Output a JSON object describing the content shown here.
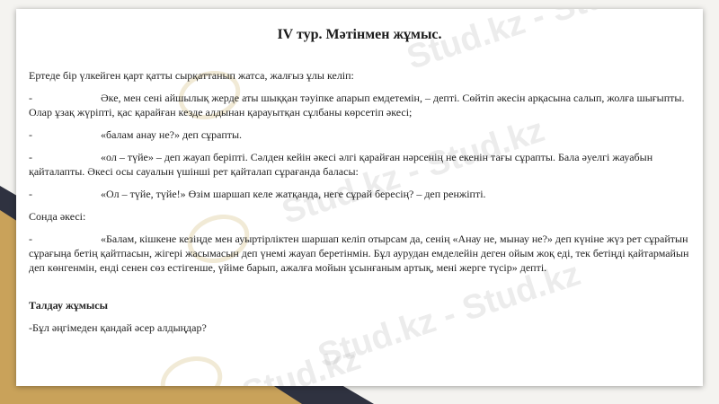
{
  "title": "IV тур. Мәтінмен жұмыс.",
  "paragraphs": {
    "p1": "Ертеде бір үлкейген қарт қатты сырқаттанып жатса, жалғыз ұлы келіп:",
    "p2_dash": "-",
    "p2": "Әке, мен сені айшылық жерде аты шыққан тәуіпке апарып емдетемін, – депті. Сөйтіп әкесін арқасына салып, жолға шығыпты. Олар ұзақ жүріпті, қас қарайған кезде алдынан қарауытқан сұлбаны көрсетіп әкесі;",
    "p3_dash": "-",
    "p3": "«балам анау не?» деп сұрапты.",
    "p4_dash": "-",
    "p4": "«ол – түйе» – деп жауап беріпті. Сәлден кейін әкесі әлгі қарайған нәрсенің не екенін тағы сұрапты. Бала әуелгі жауабын қайталапты. Әкесі осы сауалын үшінші рет қайталап сұрағанда баласы:",
    "p5_dash": "-",
    "p5": "«Ол – түйе, түйе!» Өзім шаршап келе жатқанда, неге сұрай бересің? – деп ренжіпті.",
    "p6": "Сонда әкесі:",
    "p7_dash": "-",
    "p7": "«Балам, кішкене кезіңде мен ауыртірліктен шаршап келіп отырсам да, сенің «Анау не, мынау не?» деп күніне жүз рет сұрайтын сұрағыңа бетің қайтпасын, жігері жасымасын деп үнемі жауап беретінмін. Бұл аурудан емделейін деген ойым жоқ еді, тек бетіңді қайтармайын деп көнгенмін, енді сенен сөз естігенше, үйіме барып, ажалға мойын ұсынғаным артық, мені жерге түсір» депті.",
    "section_title": "Талдау жұмысы",
    "question": "-Бұл әңгімеден қандай әсер алдыңдар?"
  },
  "watermarks": [
    "Stud.kz - Stud.",
    "Stud.kz - Stud.kz",
    "Stud.kz - Stud.kz",
    "Stud.kz"
  ]
}
